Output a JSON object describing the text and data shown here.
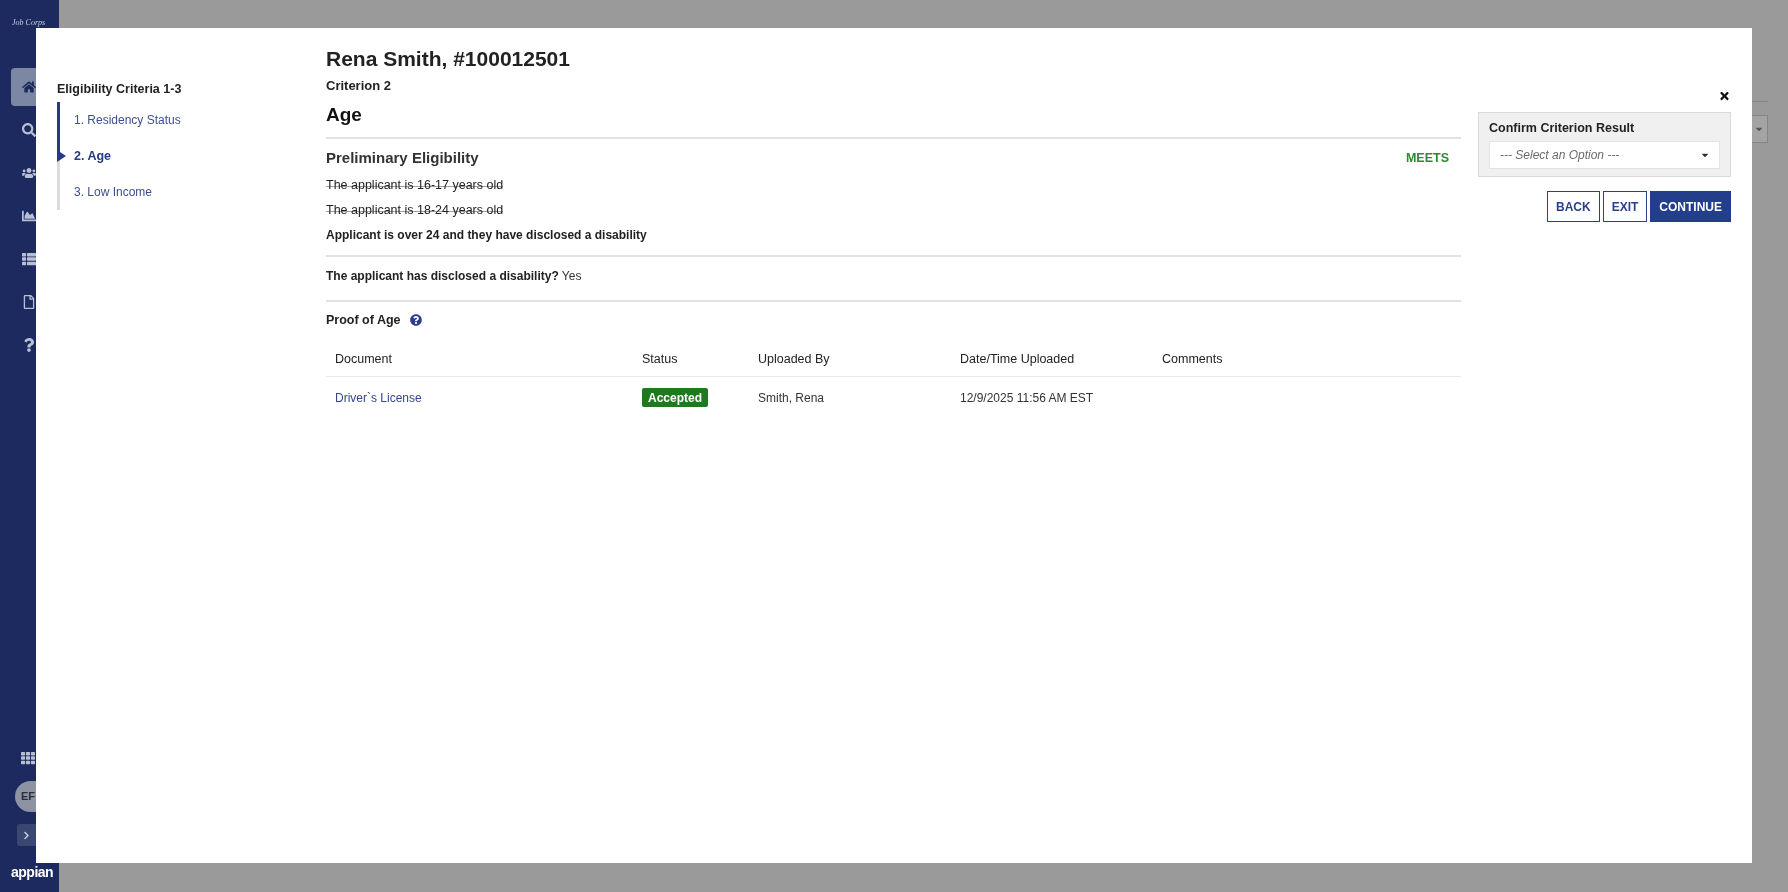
{
  "app_nav": {
    "logo": "Job Corps",
    "items": [
      {
        "selected": true
      },
      {
        "selected": false
      },
      {
        "selected": false
      },
      {
        "selected": false
      },
      {
        "selected": false
      },
      {
        "selected": false
      },
      {
        "selected": false
      }
    ],
    "avatar": {
      "initials": "EF"
    },
    "brand": "appian"
  },
  "modal": {
    "steps": {
      "title": "Eligibility Criteria 1-3",
      "items": [
        {
          "label": "1. Residency Status",
          "selected": false
        },
        {
          "label": "2. Age",
          "selected": true
        },
        {
          "label": "3. Low Income",
          "selected": false
        }
      ]
    },
    "title": "Rena Smith, #100012501",
    "criterion": "Criterion 2",
    "criterion_name": "Age",
    "preliminary_eligibility": {
      "heading": "Preliminary Eligibility",
      "result": "MEETS",
      "conditions": [
        {
          "text": "The applicant is 16-17 years old",
          "met": false
        },
        {
          "text": "The applicant is 18-24 years old",
          "met": false
        },
        {
          "text": "Applicant is over 24 and they have disclosed a disability",
          "met": true
        }
      ]
    },
    "disclosure": {
      "question": "The applicant has disclosed a disability?",
      "answer": "Yes"
    },
    "proof": {
      "heading": "Proof of Age",
      "table": {
        "columns": [
          "Document",
          "Status",
          "Uploaded By",
          "Date/Time Uploaded",
          "Comments"
        ],
        "rows": [
          {
            "document": "Driver`s License",
            "status": "Accepted",
            "uploaded_by": "Smith, Rena",
            "uploaded_at": "12/9/2025 11:56 AM EST"
          }
        ]
      }
    },
    "confirm_result": {
      "label": "Confirm Criterion Result",
      "placeholder": "--- Select an Option ---"
    },
    "buttons": [
      {
        "label": "BACK",
        "primary": false
      },
      {
        "label": "EXIT",
        "primary": false
      },
      {
        "label": "CONTINUE",
        "primary": true
      }
    ]
  }
}
